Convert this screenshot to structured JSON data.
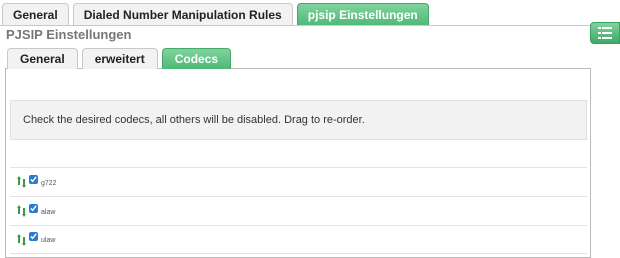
{
  "top_tabs": [
    {
      "label": "General"
    },
    {
      "label": "Dialed Number Manipulation Rules"
    },
    {
      "label": "pjsip Einstellungen"
    }
  ],
  "section": {
    "title": "PJSIP Einstellungen"
  },
  "inner_tabs": [
    {
      "label": "General"
    },
    {
      "label": "erweitert"
    },
    {
      "label": "Codecs"
    }
  ],
  "notice": {
    "text": "Check the desired codecs, all others will be disabled. Drag to re-order."
  },
  "codecs": [
    {
      "label": "g722",
      "checked": true
    },
    {
      "label": "alaw",
      "checked": true
    },
    {
      "label": "ulaw",
      "checked": true
    }
  ],
  "colors": {
    "accent": "#4fb876",
    "checkbox": "#2b7bd1"
  },
  "icons": {
    "side_button": "list-icon",
    "drag_handle": "up-down-arrows-icon"
  }
}
